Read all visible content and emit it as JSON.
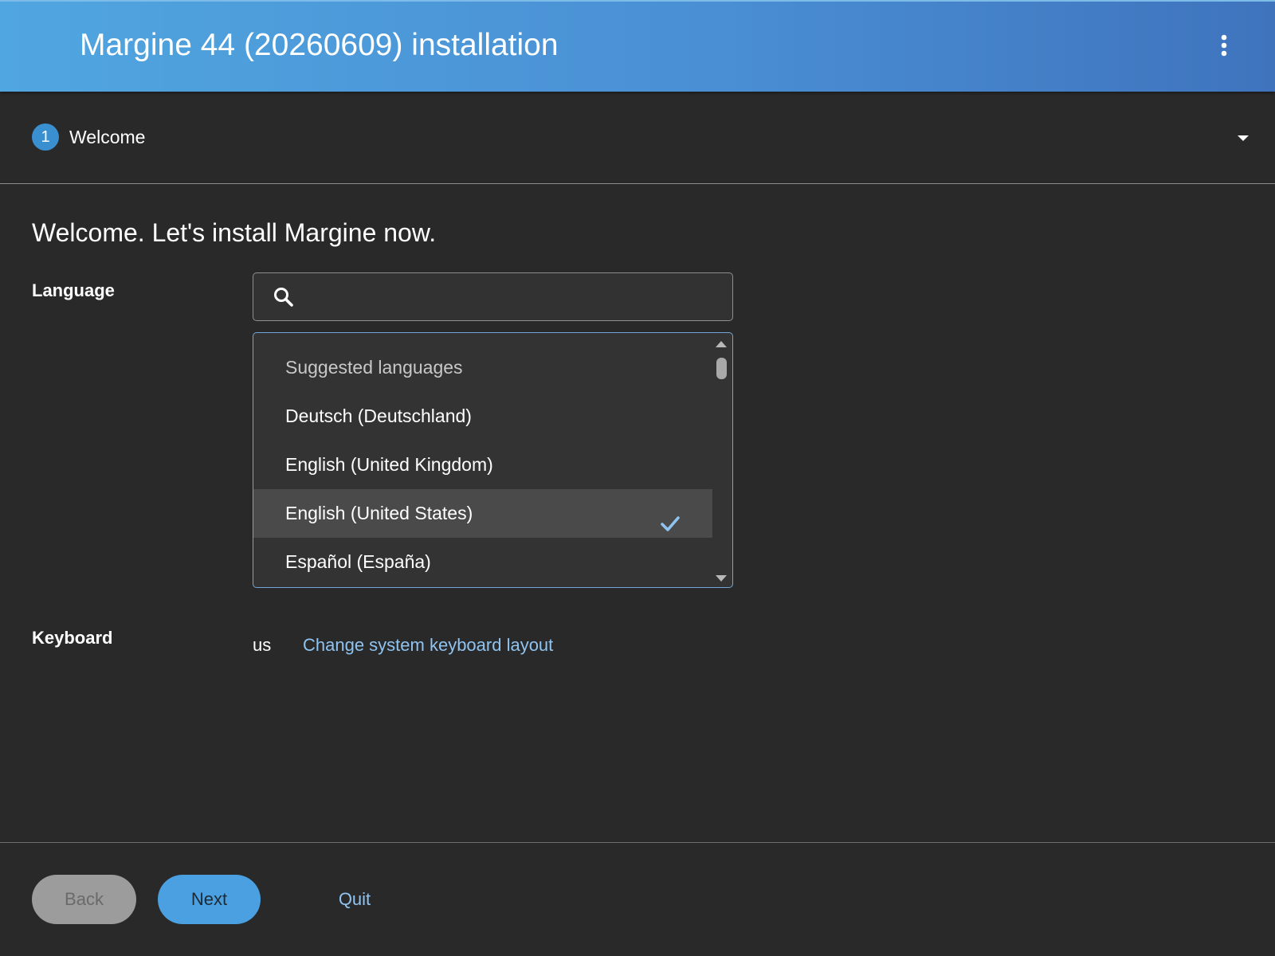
{
  "header": {
    "title": "Margine 44 (20260609) installation",
    "menu_icon": "kebab-menu-icon"
  },
  "stepbar": {
    "step_number": "1",
    "step_label": "Welcome",
    "toggle_icon": "caret-down-icon"
  },
  "main": {
    "title": "Welcome. Let's install Margine now.",
    "language": {
      "label": "Language",
      "search": {
        "value": "",
        "placeholder": "",
        "icon": "search-icon"
      },
      "list": {
        "group_header": "Suggested languages",
        "items": [
          {
            "label": "Deutsch (Deutschland)",
            "selected": false
          },
          {
            "label": "English (United Kingdom)",
            "selected": false
          },
          {
            "label": "English (United States)",
            "selected": true
          },
          {
            "label": "Español (España)",
            "selected": false
          }
        ],
        "selected_icon": "checkmark-icon"
      }
    },
    "keyboard": {
      "label": "Keyboard",
      "value": "us",
      "change_link": "Change system keyboard layout"
    }
  },
  "footer": {
    "back_label": "Back",
    "next_label": "Next",
    "quit_label": "Quit"
  },
  "colors": {
    "header_gradient_start": "#50a6e0",
    "header_gradient_end": "#3f74bd",
    "background": "#292929",
    "accent": "#4aa0e0",
    "link": "#8fc3f0",
    "selected_row": "#4a4a4a"
  }
}
